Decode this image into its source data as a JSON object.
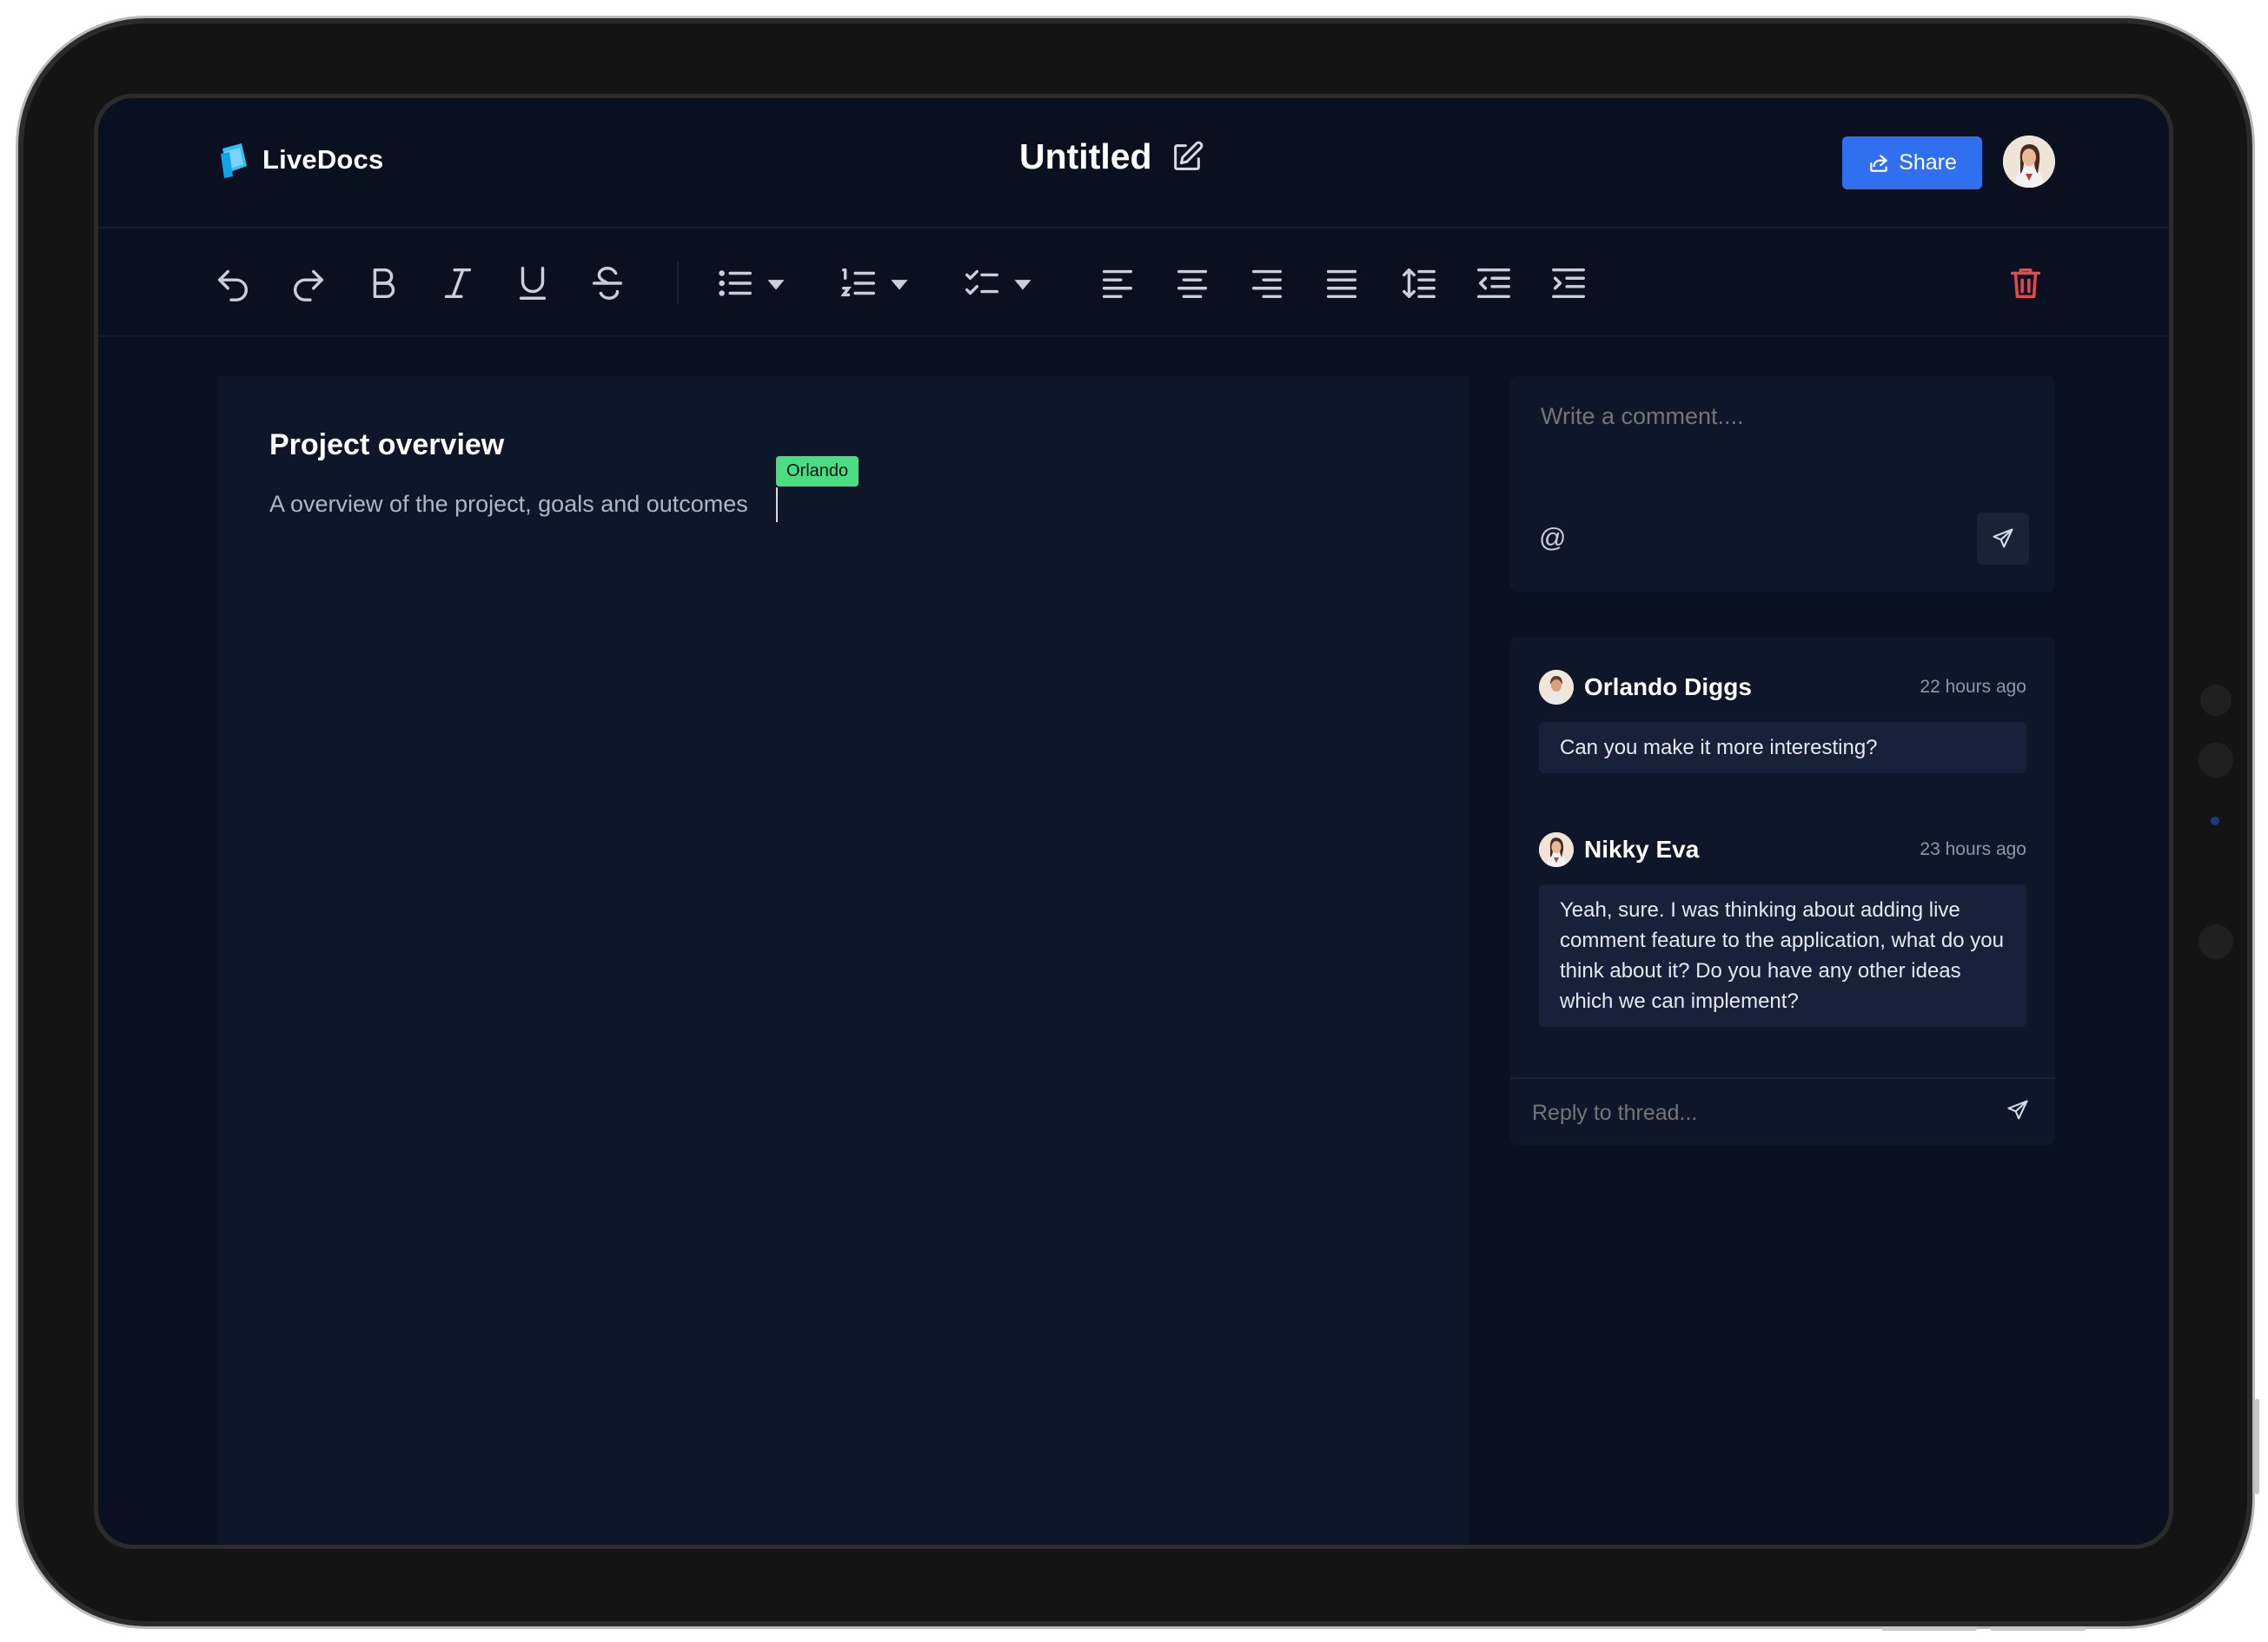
{
  "app": {
    "name": "LiveDocs"
  },
  "document": {
    "title": "Untitled"
  },
  "header": {
    "share_label": "Share"
  },
  "toolbar": {
    "icons": [
      "undo-icon",
      "redo-icon",
      "bold-icon",
      "italic-icon",
      "underline-icon",
      "strikethrough-icon",
      "bullet-list-icon",
      "numbered-list-icon",
      "checklist-icon",
      "align-left-icon",
      "align-center-icon",
      "align-right-icon",
      "align-justify-icon",
      "line-height-icon",
      "outdent-icon",
      "indent-icon",
      "trash-icon"
    ],
    "accent_delete": "#e5484d"
  },
  "editor": {
    "heading": "Project overview",
    "body": "A overview of the project, goals and outcomes",
    "cursor_user": "Orlando",
    "cursor_color": "#4ade80"
  },
  "composer": {
    "placeholder": "Write a comment....",
    "mention_symbol": "@"
  },
  "thread": {
    "comments": [
      {
        "author": "Orlando Diggs",
        "time": "22 hours ago",
        "text": "Can you make it more interesting?"
      },
      {
        "author": "Nikky Eva",
        "time": "23 hours ago",
        "text": "Yeah, sure. I was thinking about adding live comment feature to the application, what do you think about it? Do you have any other ideas which we can implement?"
      }
    ],
    "reply_placeholder": "Reply to thread..."
  },
  "colors": {
    "background": "#0b1020",
    "panel": "#0e1629",
    "brand": "#2f6ff0"
  }
}
